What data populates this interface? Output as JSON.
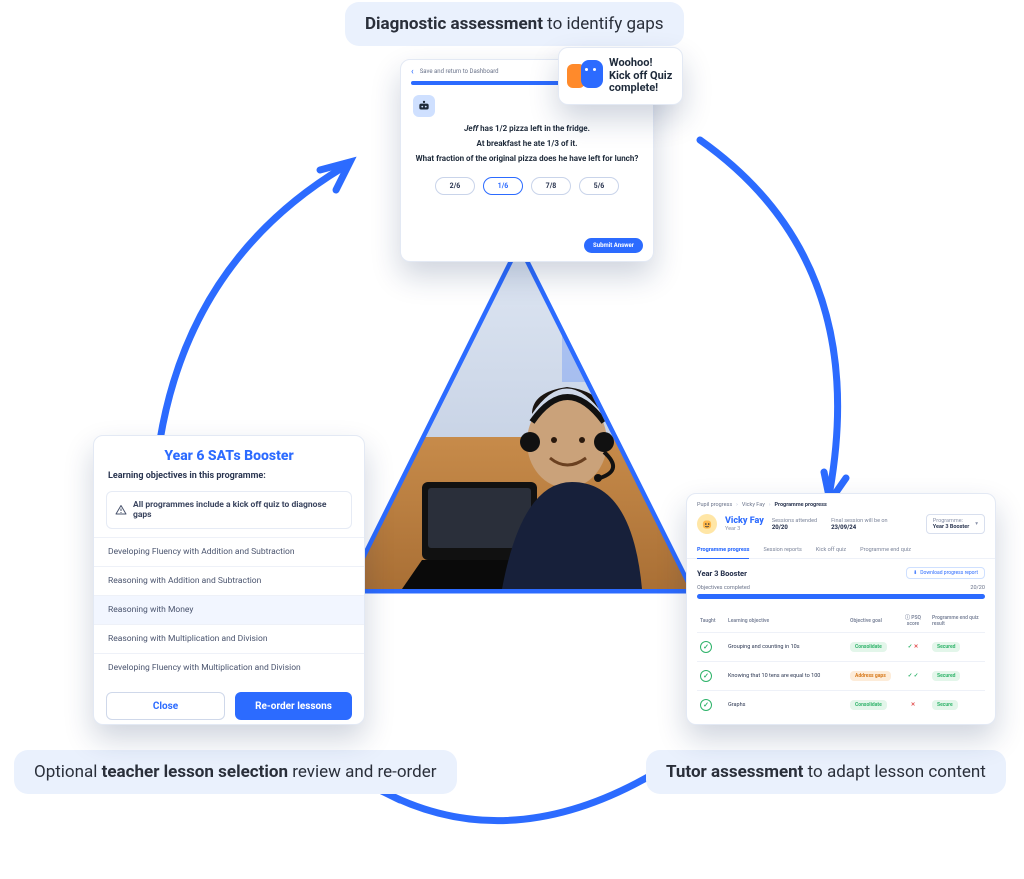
{
  "captions": {
    "top_bold": "Diagnostic assessment",
    "top_rest": " to identify gaps",
    "left_pre": "Optional ",
    "left_bold": "teacher lesson selection",
    "left_rest": " review and re-order",
    "right_bold": "Tutor assessment",
    "right_rest": " to adapt lesson content"
  },
  "quiz": {
    "back": "Save and return to Dashboard",
    "q1": "Jeff has 1/2 pizza left in the fridge.",
    "q2": "At breakfast he ate 1/3 of it.",
    "q3": "What fraction of the original pizza does he have left for lunch?",
    "opts": [
      "2/6",
      "1/6",
      "7/8",
      "5/6"
    ],
    "selected": 1,
    "submit": "Submit Answer"
  },
  "woo": {
    "l1": "Woohoo!",
    "l2": "Kick off Quiz",
    "l3": "complete!"
  },
  "sel": {
    "title": "Year 6 SATs Booster",
    "sub": "Learning objectives in this programme:",
    "note": "All programmes include a kick off quiz to diagnose gaps",
    "rows": [
      "Developing Fluency with Addition and Subtraction",
      "Reasoning with Addition and Subtraction",
      "Reasoning with Money",
      "Reasoning with Multiplication and Division",
      "Developing Fluency with Multiplication and Division"
    ],
    "close": "Close",
    "reorder": "Re-order lessons"
  },
  "tutor": {
    "crumbs": [
      "Pupil progress",
      "Vicky Fay",
      "Programme progress"
    ],
    "name": "Vicky Fay",
    "year": "Year 3",
    "stat1_label": "Sessions attended",
    "stat1_val": "20/20",
    "stat2_label": "Final session will be on",
    "stat2_val": "23/09/24",
    "prog_label": "Programme:",
    "prog_val": "Year 3 Booster",
    "tabs": [
      "Programme progress",
      "Session reports",
      "Kick off quiz",
      "Programme end quiz"
    ],
    "section_title": "Year 3 Booster",
    "download": "Download progress report",
    "obj_label": "Objectives completed",
    "obj_val": "20/20",
    "th": [
      "Taught",
      "Learning objective",
      "Objective goal",
      "PSQ score",
      "Programme end quiz result"
    ],
    "rows": [
      {
        "obj": "Grouping and counting in 10s",
        "goal": "Consolidate",
        "goal_c": "green",
        "psq_ok": true,
        "psq_no": true,
        "res": "Secured"
      },
      {
        "obj": "Knowing that 10 tens are equal to 100",
        "goal": "Address gaps",
        "goal_c": "orange",
        "psq_ok": true,
        "psq_no": false,
        "res": "Secured"
      },
      {
        "obj": "Graphs",
        "goal": "Consolidate",
        "goal_c": "green",
        "psq_ok": false,
        "psq_no": true,
        "res": "Secure"
      }
    ]
  }
}
